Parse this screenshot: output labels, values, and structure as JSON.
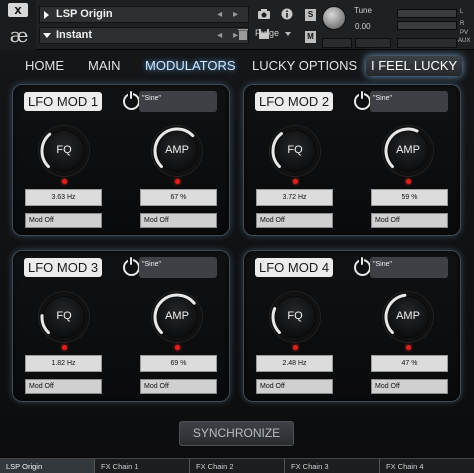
{
  "header": {
    "close_glyph": "x",
    "logo_text": "æ",
    "instrument_name": "LSP Origin",
    "snapshot_name": "Instant",
    "arrows_text": "◂ ▸",
    "purge_label": "Purge",
    "s_label": "S",
    "m_label": "M",
    "tune_label": "Tune",
    "tune_value": "0.00",
    "meter_l": "L",
    "meter_r": "R",
    "aux_label": "AUX",
    "pv_label": "PV"
  },
  "nav": {
    "tabs": [
      {
        "label": "HOME"
      },
      {
        "label": "MAIN"
      },
      {
        "label": "MODULATORS"
      },
      {
        "label": "LUCKY OPTIONS"
      },
      {
        "label": "I FEEL LUCKY"
      }
    ]
  },
  "panels": [
    {
      "title": "LFO MOD 1",
      "wave": "\"Sine\"",
      "fq_label": "FQ",
      "fq_value": "3.63 Hz",
      "fq_level": 0.35,
      "amp_label": "AMP",
      "amp_value": "67 %",
      "amp_level": 0.67,
      "fq_mod": "Mod Off",
      "amp_mod": "Mod Off"
    },
    {
      "title": "LFO MOD 2",
      "wave": "\"Sine\"",
      "fq_label": "FQ",
      "fq_value": "3.72 Hz",
      "fq_level": 0.36,
      "amp_label": "AMP",
      "amp_value": "59 %",
      "amp_level": 0.59,
      "fq_mod": "Mod Off",
      "amp_mod": "Mod Off"
    },
    {
      "title": "LFO MOD 3",
      "wave": "\"Sine\"",
      "fq_label": "FQ",
      "fq_value": "1.82 Hz",
      "fq_level": 0.18,
      "amp_label": "AMP",
      "amp_value": "69 %",
      "amp_level": 0.69,
      "fq_mod": "Mod Off",
      "amp_mod": "Mod Off"
    },
    {
      "title": "LFO MOD 4",
      "wave": "\"Sine\"",
      "fq_label": "FQ",
      "fq_value": "2.48 Hz",
      "fq_level": 0.25,
      "amp_label": "AMP",
      "amp_value": "47 %",
      "amp_level": 0.47,
      "fq_mod": "Mod Off",
      "amp_mod": "Mod Off"
    }
  ],
  "sync_label": "SYNCHRONIZE",
  "bottom_tabs": [
    {
      "label": "LSP Origin"
    },
    {
      "label": "FX Chain 1"
    },
    {
      "label": "FX Chain 2"
    },
    {
      "label": "FX Chain 3"
    },
    {
      "label": "FX Chain 4"
    }
  ],
  "colors": {
    "accent_glow": "#6fb8ff",
    "indicator_red": "#e02020",
    "knob_arc": "#e8e8e8"
  }
}
